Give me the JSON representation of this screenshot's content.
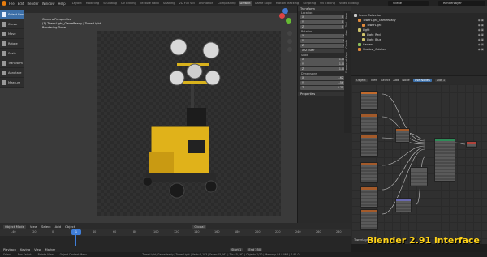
{
  "topbar": {
    "menu": [
      "File",
      "Edit",
      "Render",
      "Window",
      "Help"
    ],
    "workspaces": [
      "Layout",
      "Modeling",
      "Sculpting",
      "UV Editing",
      "Texture Paint",
      "Shading",
      "2D Full Vid",
      "Animation",
      "Compositing",
      "Default",
      "Game Logic",
      "Motion Tracking",
      "Scripting",
      "UV Editing",
      "Video Editing"
    ],
    "active_workspace": "Default",
    "scene": "Scene",
    "view_layer": "RenderLayer"
  },
  "tools": [
    "Select Box",
    "Cursor",
    "Move",
    "Rotate",
    "Scale",
    "Transform",
    "Annotate",
    "Measure"
  ],
  "viewport": {
    "overlay_lines": [
      "Camera Perspective",
      "(1) TowerLight_GameReady | TowerLight",
      "Rendering Done"
    ],
    "mode": "Object Mode",
    "menus": [
      "View",
      "Select",
      "Add",
      "Object"
    ],
    "orientation": "Global"
  },
  "npanel": {
    "header": "Transform",
    "location_label": "Location",
    "location": [
      {
        "axis": "X",
        "value": "0 m"
      },
      {
        "axis": "Y",
        "value": "0 m"
      },
      {
        "axis": "Z",
        "value": "0 m"
      }
    ],
    "rotation_label": "Rotation",
    "rotation": [
      {
        "axis": "X",
        "value": "0°"
      },
      {
        "axis": "Y",
        "value": "0°"
      },
      {
        "axis": "Z",
        "value": "0°"
      }
    ],
    "rotation_mode": "XYZ Euler",
    "scale_label": "Scale",
    "scale": [
      {
        "axis": "X",
        "value": "1.000"
      },
      {
        "axis": "Y",
        "value": "1.000"
      },
      {
        "axis": "Z",
        "value": "1.000"
      }
    ],
    "dimensions_label": "Dimensions",
    "dimensions": [
      {
        "axis": "X",
        "value": "1.62 m"
      },
      {
        "axis": "Y",
        "value": "1.56 m"
      },
      {
        "axis": "Z",
        "value": "2.75 m"
      }
    ],
    "properties_label": "Properties",
    "tabs": [
      "Item",
      "Tool",
      "View",
      "Create",
      "Screencast Keys"
    ]
  },
  "outliner": {
    "title": "Scene Collection",
    "items": [
      {
        "label": "Scene Collection",
        "color": "#cccccc",
        "indent": 0
      },
      {
        "label": "TowerLight_GameReady",
        "color": "#e08a3c",
        "indent": 1
      },
      {
        "label": "TowerLight",
        "color": "#e08a3c",
        "indent": 2
      },
      {
        "label": "Light",
        "color": "#cfc36b",
        "indent": 1
      },
      {
        "label": "Light_Red",
        "color": "#cfc36b",
        "indent": 2
      },
      {
        "label": "Light_Blue",
        "color": "#cfc36b",
        "indent": 2
      },
      {
        "label": "Camera",
        "color": "#8bbf5b",
        "indent": 1
      },
      {
        "label": "Shadow_Catcher",
        "color": "#e08a3c",
        "indent": 1
      }
    ]
  },
  "node_editor": {
    "mode": "Object",
    "menus": [
      "View",
      "Select",
      "Add",
      "Node"
    ],
    "use_nodes_label": "Use Nodes",
    "slot": "Slot 1",
    "object_name": "TowerLight",
    "nodes": [
      {
        "header": "#c26a2c"
      },
      {
        "header": "#a35a2a"
      },
      {
        "header": "#a35a2a"
      },
      {
        "header": "#a35a2a"
      },
      {
        "header": "#a35a2a"
      },
      {
        "header": "#a35a2a"
      },
      {
        "header": "#a35a2a"
      },
      {
        "header": "#6a6ab0"
      },
      {
        "header": "#2e8c58"
      },
      {
        "header": "#b0423a"
      },
      {
        "header": "#5a5a5a"
      }
    ]
  },
  "timeline": {
    "menus": [
      "Playback",
      "Keying",
      "View",
      "Marker"
    ],
    "ticks": [
      "-40",
      "-20",
      "0",
      "20",
      "40",
      "60",
      "80",
      "100",
      "120",
      "140",
      "160",
      "180",
      "200",
      "220",
      "240",
      "260",
      "280"
    ],
    "current_frame": "1",
    "start_label": "Start",
    "start": "1",
    "end_label": "End",
    "end": "250"
  },
  "statusbar": {
    "items": [
      "Select",
      "Box Select",
      "Rotate View",
      "Object Context Menu"
    ],
    "stats": "TowerLight_GameReady | TowerLight | Verts:8,103 | Faces:15,162 | Tris:15,162 | Objects:1/10 | Memory: 84.8 MiB | 2.91.0"
  },
  "brand": "Blender 2.91 interface",
  "colors": {
    "accent": "#3c6fa8",
    "playhead": "#3f7ed8",
    "brand": "#ffd319"
  }
}
